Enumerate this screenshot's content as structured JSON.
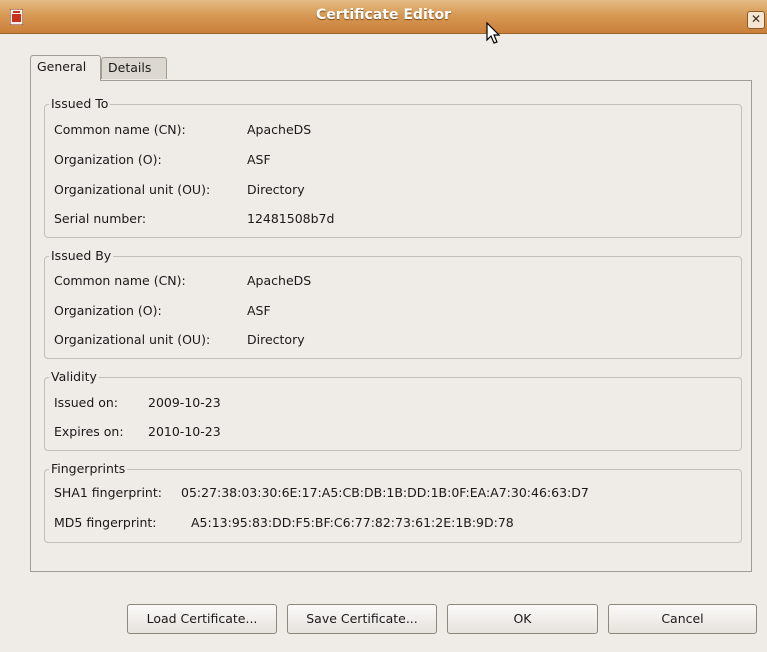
{
  "window": {
    "title": "Certificate Editor",
    "close_label": "✕"
  },
  "tabs": [
    {
      "label": "General"
    },
    {
      "label": "Details"
    }
  ],
  "issued_to": {
    "legend": "Issued To",
    "rows": [
      {
        "label": "Common name (CN):",
        "value": "ApacheDS"
      },
      {
        "label": "Organization (O):",
        "value": "ASF"
      },
      {
        "label": "Organizational unit (OU):",
        "value": "Directory"
      },
      {
        "label": "Serial number:",
        "value": "12481508b7d"
      }
    ]
  },
  "issued_by": {
    "legend": "Issued By",
    "rows": [
      {
        "label": "Common name (CN):",
        "value": "ApacheDS"
      },
      {
        "label": "Organization (O):",
        "value": "ASF"
      },
      {
        "label": "Organizational unit (OU):",
        "value": "Directory"
      }
    ]
  },
  "validity": {
    "legend": "Validity",
    "rows": [
      {
        "label": "Issued on:",
        "value": "2009-10-23"
      },
      {
        "label": "Expires on:",
        "value": "2010-10-23"
      }
    ]
  },
  "fingerprints": {
    "legend": "Fingerprints",
    "rows": [
      {
        "label": "SHA1 fingerprint:",
        "value": "05:27:38:03:30:6E:17:A5:CB:DB:1B:DD:1B:0F:EA:A7:30:46:63:D7"
      },
      {
        "label": "MD5 fingerprint:",
        "value": "A5:13:95:83:DD:F5:BF:C6:77:82:73:61:2E:1B:9D:78"
      }
    ]
  },
  "buttons": {
    "load": "Load Certificate...",
    "save": "Save Certificate...",
    "ok": "OK",
    "cancel": "Cancel"
  }
}
